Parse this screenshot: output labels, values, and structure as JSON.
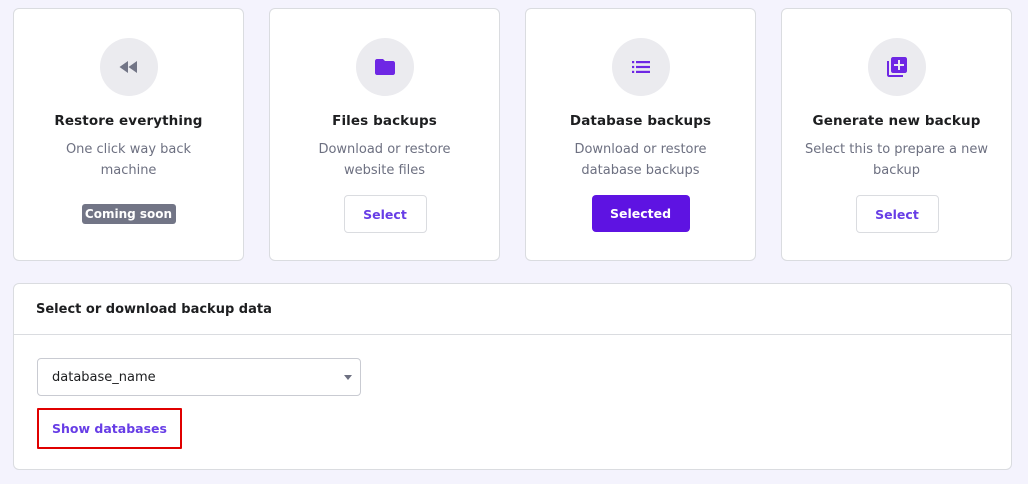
{
  "cards": [
    {
      "icon": "rewind-icon",
      "title": "Restore everything",
      "description": "One click way back machine",
      "action": {
        "type": "badge",
        "label": "Coming soon"
      }
    },
    {
      "icon": "folder-icon",
      "title": "Files backups",
      "description": "Download or restore website files",
      "action": {
        "type": "button",
        "label": "Select"
      }
    },
    {
      "icon": "list-icon",
      "title": "Database backups",
      "description": "Download or restore database backups",
      "action": {
        "type": "button-selected",
        "label": "Selected"
      }
    },
    {
      "icon": "add-box-icon",
      "title": "Generate new backup",
      "description": "Select this to prepare a new backup",
      "action": {
        "type": "button",
        "label": "Select"
      }
    }
  ],
  "panel": {
    "title": "Select or download backup data",
    "select": {
      "value": "database_name"
    },
    "show_button_label": "Show databases"
  },
  "colors": {
    "accent": "#673de6",
    "accent_filled": "#5e13e2",
    "icon_purple": "#6e27e4",
    "badge_gray": "#727586",
    "highlight_border": "#e00000"
  }
}
